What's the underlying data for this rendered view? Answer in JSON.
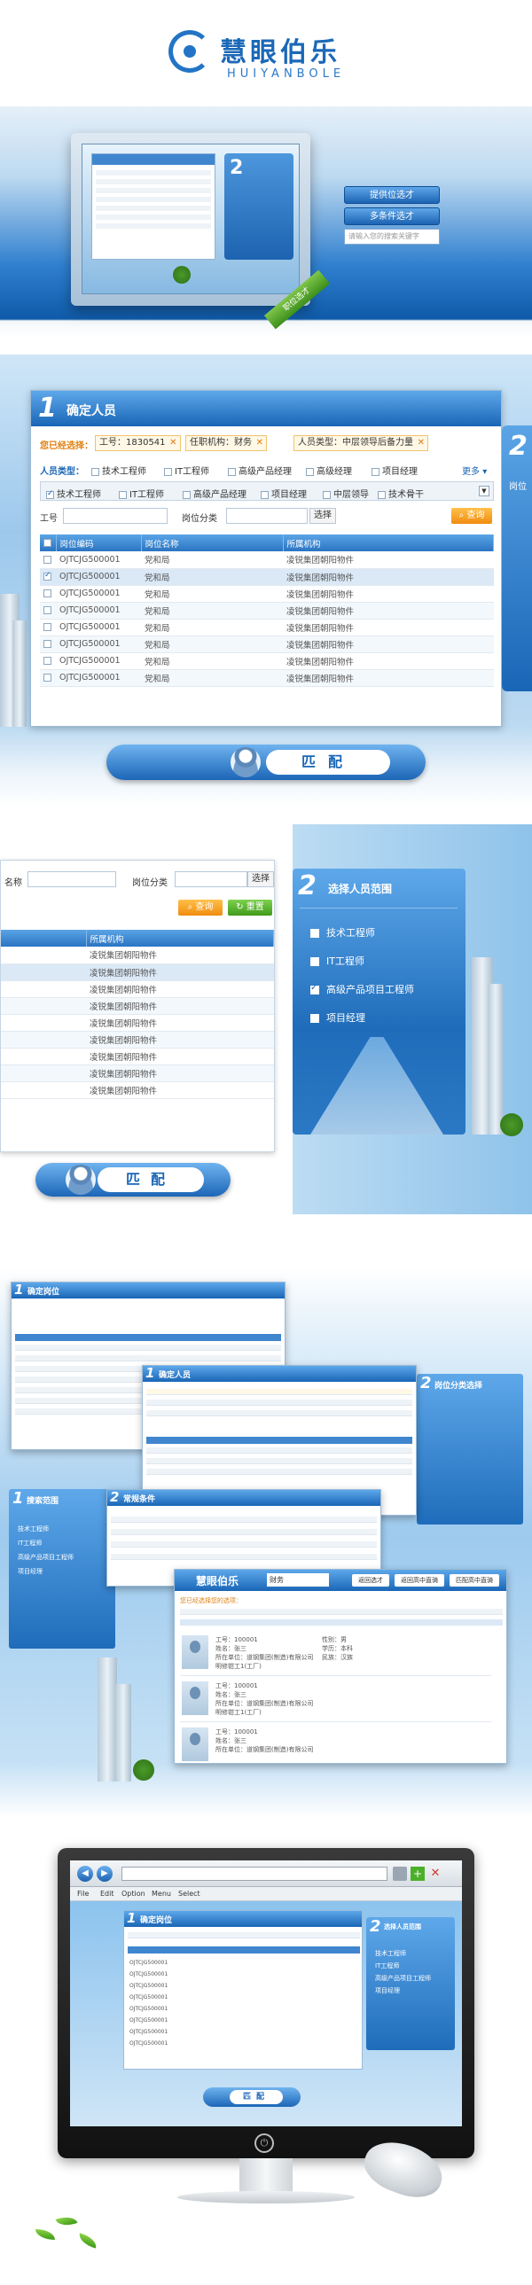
{
  "hero": {
    "logo_cn": "慧眼伯乐",
    "logo_en": "HUIYANBOLE",
    "buttons": [
      "提供位选才",
      "多条件选才"
    ],
    "search_placeholder": "请输入您的搜索关键字",
    "ribbon": "职位选才"
  },
  "step1": {
    "number": "1",
    "title": "确定人员",
    "chips_label": "您已经选择：",
    "chips": [
      "工号：1830541",
      "任职机构：财务",
      "人员类型：中层领导后备力量"
    ],
    "types_label": "人员类型：",
    "types": [
      "技术工程师",
      "IT工程师",
      "高级产品经理",
      "高级经理",
      "项目经理"
    ],
    "more": "更多",
    "selected_types": [
      "技术工程师",
      "IT工程师",
      "高级产品经理",
      "项目经理",
      "中层领导",
      "技术骨干"
    ],
    "filter": {
      "id_label": "工号",
      "category_label": "岗位分类",
      "choose_btn": "选择",
      "search_btn": "查询"
    },
    "table": {
      "headers": [
        "岗位编码",
        "岗位名称",
        "所属机构"
      ],
      "rows": [
        [
          "OJTCJG500001",
          "党和局",
          "凌锐集团朝阳物件"
        ],
        [
          "OJTCJG500001",
          "党和局",
          "凌锐集团朝阳物件"
        ],
        [
          "OJTCJG500001",
          "党和局",
          "凌锐集团朝阳物件"
        ],
        [
          "OJTCJG500001",
          "党和局",
          "凌锐集团朝阳物件"
        ],
        [
          "OJTCJG500001",
          "党和局",
          "凌锐集团朝阳物件"
        ],
        [
          "OJTCJG500001",
          "党和局",
          "凌锐集团朝阳物件"
        ],
        [
          "OJTCJG500001",
          "党和局",
          "凌锐集团朝阳物件"
        ],
        [
          "OJTCJG500001",
          "党和局",
          "凌锐集团朝阳物件"
        ]
      ]
    },
    "side_num": "2",
    "side_text": "岗位",
    "match_label": "匹配"
  },
  "step2": {
    "left": {
      "name_label": "名称",
      "category_label": "岗位分类",
      "choose_btn": "选择",
      "search_btn": "查询",
      "reset_btn": "重置",
      "col_header": "所属机构",
      "rows": [
        "凌锐集团朝阳物件",
        "凌锐集团朝阳物件",
        "凌锐集团朝阳物件",
        "凌锐集团朝阳物件",
        "凌锐集团朝阳物件",
        "凌锐集团朝阳物件",
        "凌锐集团朝阳物件",
        "凌锐集团朝阳物件",
        "凌锐集团朝阳物件"
      ]
    },
    "right": {
      "number": "2",
      "title": "选择人员范围",
      "options": [
        {
          "label": "技术工程师",
          "checked": false
        },
        {
          "label": "IT工程师",
          "checked": false
        },
        {
          "label": "高级产品项目工程师",
          "checked": true
        },
        {
          "label": "项目经理",
          "checked": false
        }
      ]
    },
    "match_label": "匹配"
  },
  "collage": {
    "win_a_title": "确定岗位",
    "win_b_title": "确定人员",
    "win_c_title": "岗位分类选择",
    "win_d_title": "搜索范围",
    "win_e_title": "常规条件",
    "win_f_logo": "慧眼伯乐",
    "win_f_search": "财务",
    "win_f_buttons": [
      "返回选才",
      "返回高中直骑",
      "匹配高中直骑"
    ],
    "win_f_chip": "您已经选择您的选项：",
    "profile_fields": [
      "工号：",
      "姓名：",
      "所在单位：",
      "",
      "操作：",
      "性别：",
      "学历：",
      "民族：",
      "学位：",
      "政治面貌：",
      "学制："
    ],
    "profile_values": [
      "100001",
      "张三",
      "道钢集团(制造)有限公司",
      "明修钳工1(工厂)",
      "男",
      "本科",
      "汉族"
    ],
    "profiles_count": "3",
    "match_label": "匹配"
  },
  "monitor": {
    "menu": [
      "File",
      "Edit",
      "Option",
      "Menu",
      "Select"
    ],
    "window_title": "确定岗位",
    "panel_number": "2",
    "panel_title": "选择人员范围",
    "panel_options": [
      "技术工程师",
      "IT工程师",
      "高级产品项目工程师",
      "项目经理"
    ],
    "match_label": "匹配",
    "rows": [
      "OJTCJG500001",
      "OJTCJG500001",
      "OJTCJG500001",
      "OJTCJG500001",
      "OJTCJG500001",
      "OJTCJG500001",
      "OJTCJG500001",
      "OJTCJG500001"
    ]
  },
  "colors": {
    "primary_blue": "#1a66b6",
    "accent_orange": "#f08c10",
    "accent_green": "#3f9a1a"
  }
}
